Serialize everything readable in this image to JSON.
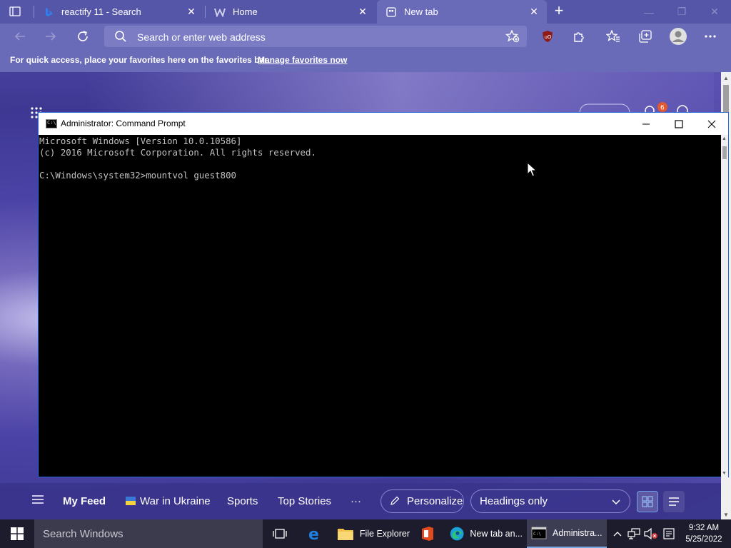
{
  "browser": {
    "tabs": [
      {
        "title": "reactify 11 - Search"
      },
      {
        "title": "Home"
      },
      {
        "title": "New tab"
      }
    ],
    "address": {
      "placeholder": "Search or enter web address"
    },
    "favorites_bar": {
      "message": "For quick access, place your favorites here on the favorites bar.",
      "link": "Manage favorites now"
    },
    "extension_badge": "6"
  },
  "feed_nav": {
    "items": [
      "My Feed",
      "War in Ukraine",
      "Sports",
      "Top Stories",
      "···"
    ],
    "personalize": "Personalize",
    "layout_select": "Headings only"
  },
  "cmd": {
    "title": "Administrator: Command Prompt",
    "lines": [
      "Microsoft Windows [Version 10.0.10586]",
      "(c) 2016 Microsoft Corporation. All rights reserved.",
      "",
      "C:\\Windows\\system32>mountvol guest800"
    ]
  },
  "taskbar": {
    "search_placeholder": "Search Windows",
    "apps": [
      {
        "label": "File Explorer"
      },
      {
        "label": "New tab an..."
      },
      {
        "label": "Administra..."
      }
    ],
    "time": "9:32 AM",
    "date": "5/25/2022"
  }
}
